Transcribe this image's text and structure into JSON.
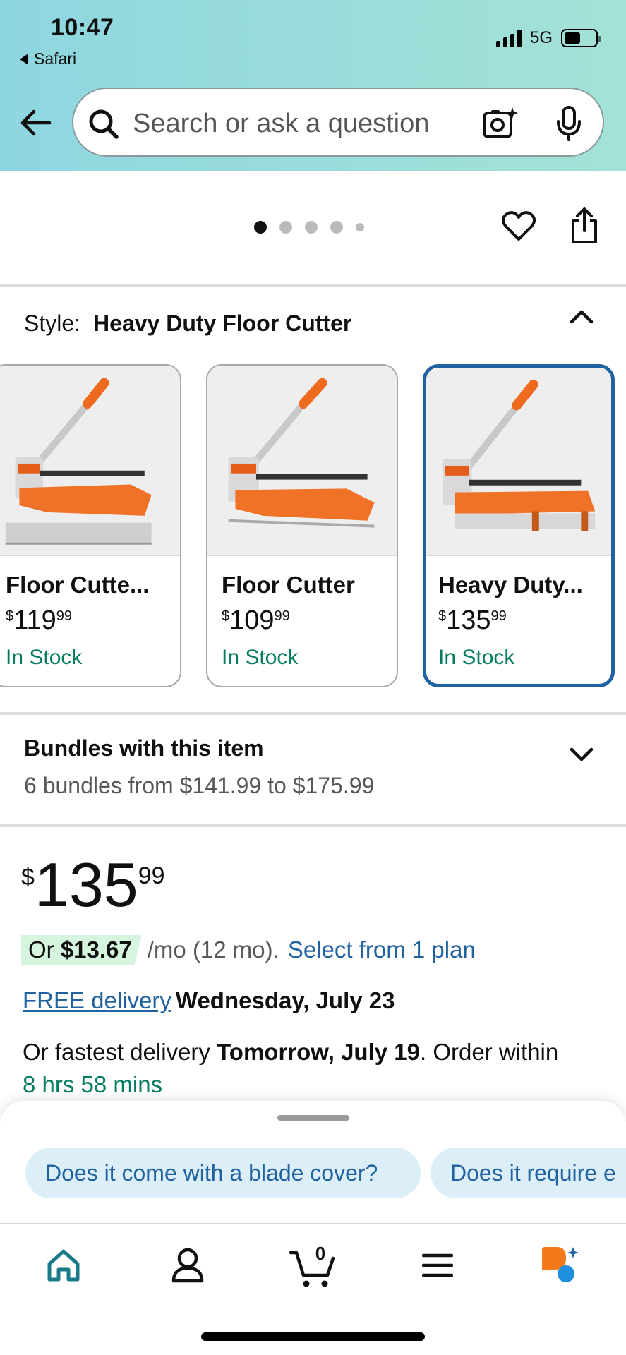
{
  "status_bar": {
    "time": "10:47",
    "back_app": "Safari",
    "network": "5G"
  },
  "search": {
    "placeholder": "Search or ask a question"
  },
  "gallery": {
    "dots": 5,
    "active_dot": 1
  },
  "style_selector": {
    "label": "Style:",
    "value": "Heavy Duty Floor Cutter",
    "options": [
      {
        "name": "Floor Cutte...",
        "price_whole": "119",
        "price_frac": "99",
        "currency": "$",
        "stock": "In Stock",
        "selected": false
      },
      {
        "name": "Floor Cutter",
        "price_whole": "109",
        "price_frac": "99",
        "currency": "$",
        "stock": "In Stock",
        "selected": false
      },
      {
        "name": "Heavy Duty...",
        "price_whole": "135",
        "price_frac": "99",
        "currency": "$",
        "stock": "In Stock",
        "selected": true
      }
    ]
  },
  "bundles": {
    "title": "Bundles with this item",
    "subtitle": "6 bundles from $141.99 to $175.99"
  },
  "price": {
    "currency": "$",
    "whole": "135",
    "fraction": "99"
  },
  "financing": {
    "prefix": "Or ",
    "amount": "$13.67",
    "terms": "/mo (12 mo).",
    "link": "Select from 1 plan"
  },
  "delivery": {
    "free_label": "FREE delivery",
    "date": "Wednesday, July 23"
  },
  "fastest": {
    "prefix": "Or fastest delivery ",
    "date": "Tomorrow, July 19",
    "suffix": ". Order within",
    "countdown": "8 hrs 58 mins"
  },
  "suggestions": [
    "Does it come with a blade cover?",
    "Does it require e"
  ],
  "bottom_nav": {
    "cart_count": "0"
  },
  "colors": {
    "accent_blue": "#2162a1",
    "stock_green": "#067d62",
    "header_teal": "#8ed6e0",
    "assistant_orange": "#f27a1a"
  }
}
